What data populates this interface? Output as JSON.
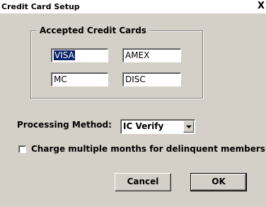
{
  "window": {
    "title": "Credit Card Setup",
    "close_label": "X"
  },
  "accepted_cards": {
    "legend": "Accepted Credit Cards",
    "cards": [
      "VISA",
      "AMEX",
      "MC",
      "DISC"
    ]
  },
  "processing": {
    "label": "Processing Method:",
    "selected": "IC Verify"
  },
  "delinquent": {
    "label": "Charge multiple months for delinquent members",
    "checked": false
  },
  "buttons": {
    "cancel": "Cancel",
    "ok": "OK"
  }
}
